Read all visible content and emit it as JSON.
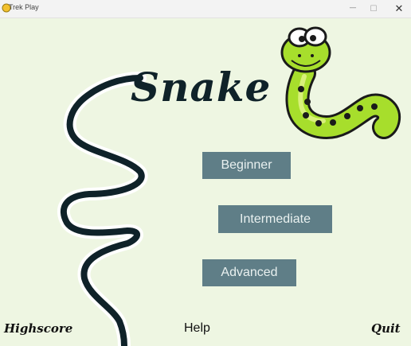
{
  "window": {
    "title": "Trek Play",
    "minimize_glyph": "—",
    "maximize_glyph": "☐",
    "close_glyph": "✕"
  },
  "game": {
    "logo_text": "Snake",
    "menu": {
      "beginner": "Beginner",
      "intermediate": "Intermediate",
      "advanced": "Advanced"
    },
    "footer": {
      "highscore": "Highscore",
      "help": "Help",
      "quit": "Quit"
    }
  },
  "colors": {
    "background": "#eef6e2",
    "button": "#5f7e87",
    "button_text": "#e9f1f0",
    "snake_body": "#a7de2c",
    "dark": "#0f2229"
  },
  "icons": {
    "app": "snake-app-icon",
    "mascot": "cartoon-snake-mascot"
  }
}
